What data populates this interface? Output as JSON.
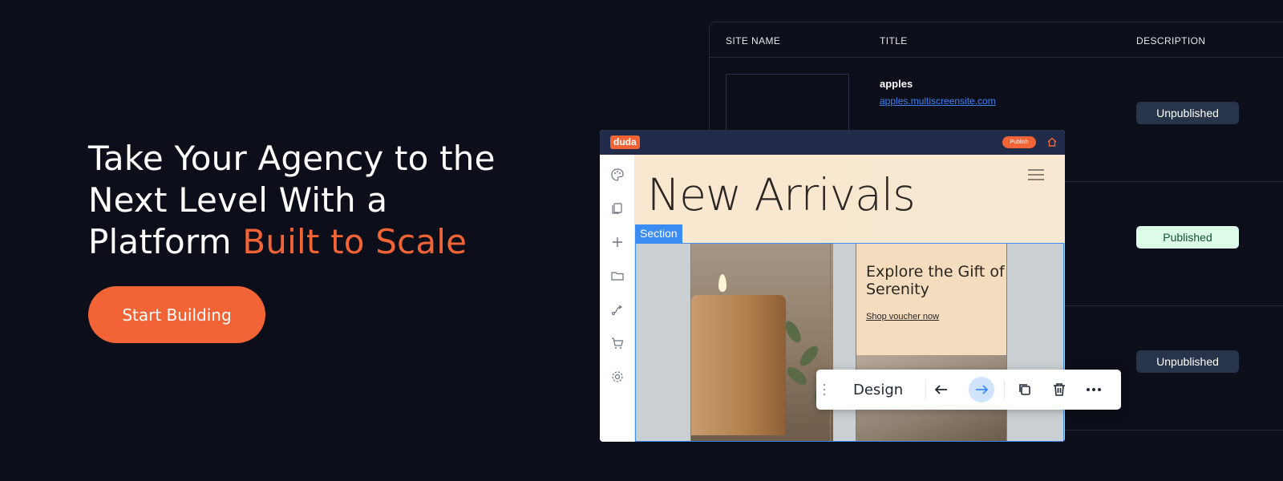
{
  "hero": {
    "title_part1": "Take Your Agency to the Next Level With a Platform",
    "title_accent": "Built to Scale",
    "cta_label": "Start Building"
  },
  "table": {
    "headers": [
      "SITE NAME",
      "TITLE",
      "DESCRIPTION"
    ],
    "rows": [
      {
        "title": "apples",
        "url": "apples.multiscreensite.com",
        "status": "Unpublished"
      },
      {
        "status": "Published"
      },
      {
        "status": "Unpublished"
      }
    ]
  },
  "editor": {
    "logo": "duda",
    "publish_label": "Publish",
    "sidebar_icons": [
      "palette-icon",
      "pages-icon",
      "add-icon",
      "folder-icon",
      "flow-icon",
      "cart-icon",
      "settings-icon"
    ],
    "page_heading": "New Arrivals",
    "section_label": "Section",
    "card_title": "Explore the Gift of Serenity",
    "card_link": "Shop voucher now"
  },
  "toolbar": {
    "design_label": "Design",
    "icons": [
      "drag-handle-icon",
      "arrow-left-icon",
      "arrow-right-icon",
      "duplicate-icon",
      "trash-icon",
      "more-icon"
    ]
  },
  "colors": {
    "background": "#0c0f19",
    "accent": "#f26336",
    "selection": "#3b8cf0",
    "editor_topbar": "#232b4b"
  }
}
